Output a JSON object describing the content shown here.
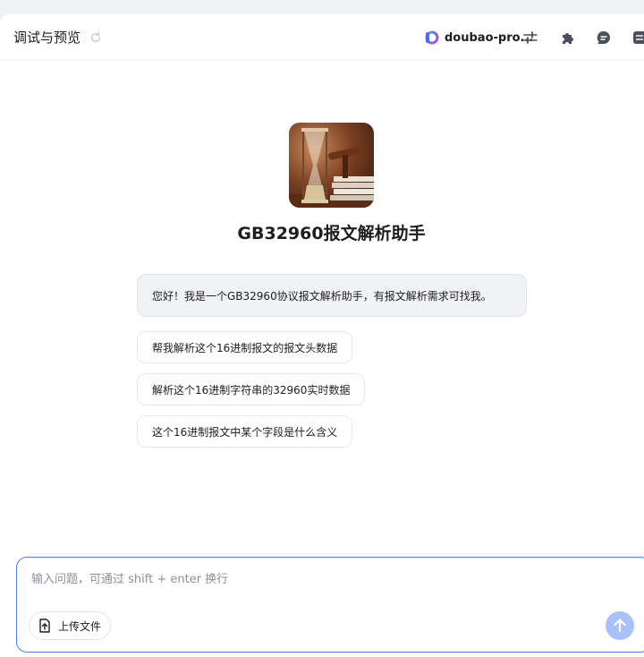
{
  "header": {
    "title": "调试与预览",
    "model_name": "doubao-pro..."
  },
  "bot": {
    "name": "GB32960报文解析助手",
    "greeting": "您好！我是一个GB32960协议报文解析助手，有报文解析需求可找我。",
    "suggestions": [
      "帮我解析这个16进制报文的报文头数据",
      "解析这个16进制字符串的32960实时数据",
      "这个16进制报文中某个字段是什么含义"
    ]
  },
  "composer": {
    "placeholder": "输入问题，可通过 shift + enter 换行",
    "upload_label": "上传文件"
  },
  "colors": {
    "accent": "#4d7cf6",
    "send_disabled": "#a8c1fb"
  },
  "icons": [
    "refresh-icon",
    "model-logo-icon",
    "settings-sliders-icon",
    "plugin-icon",
    "chat-icon",
    "menu-icon",
    "upload-icon",
    "send-arrow-icon"
  ]
}
